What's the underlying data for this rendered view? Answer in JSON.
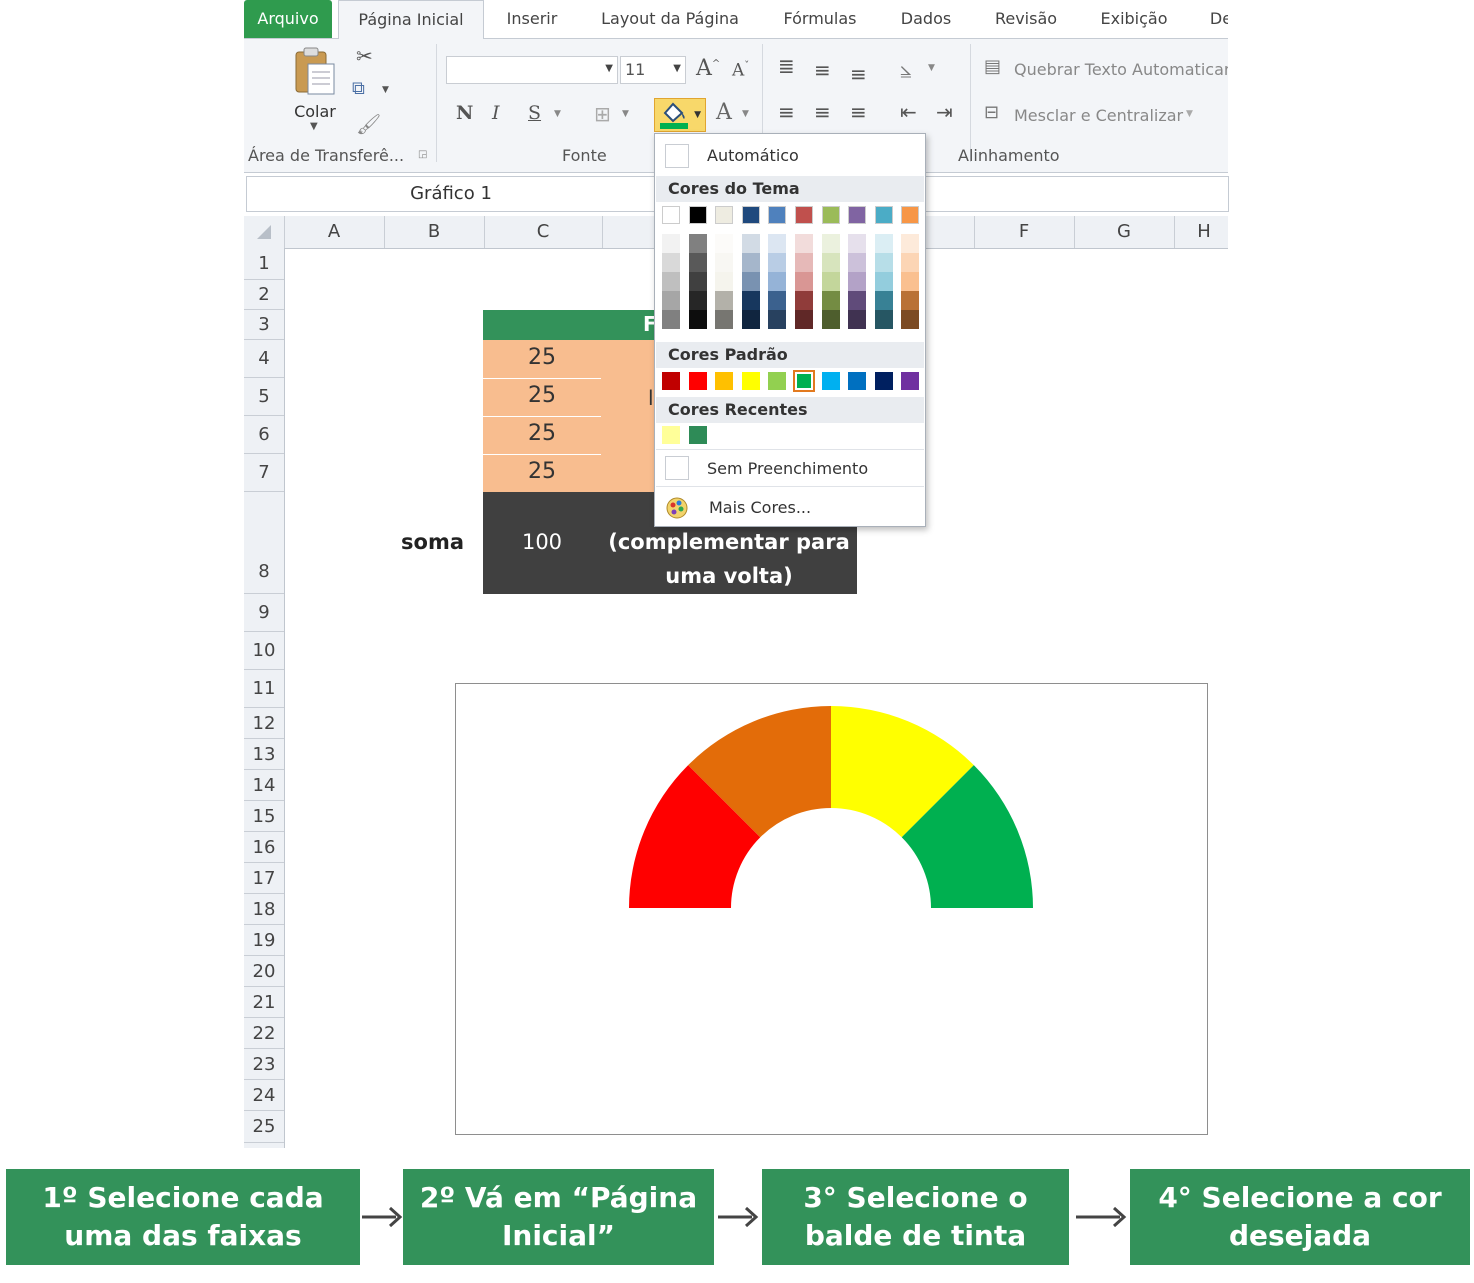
{
  "ribbon": {
    "tabs": [
      "Arquivo",
      "Página Inicial",
      "Inserir",
      "Layout da Página",
      "Fórmulas",
      "Dados",
      "Revisão",
      "Exibição",
      "De"
    ],
    "clipboard": {
      "paste_label": "Colar",
      "group_label": "Área de Transferê..."
    },
    "font": {
      "font_name": "",
      "font_size": "11",
      "bold": "N",
      "italic": "I",
      "underline": "S",
      "group_label": "Fonte"
    },
    "alignment": {
      "wrap_text": "Quebrar Texto Automaticar",
      "merge_center": "Mesclar e Centralizar",
      "group_label": "Alinhamento"
    }
  },
  "namebox": {
    "value": "Gráfico 1"
  },
  "columns": [
    "A",
    "B",
    "C",
    "F",
    "G",
    "H"
  ],
  "rows": [
    "1",
    "2",
    "3",
    "4",
    "5",
    "6",
    "7",
    "8",
    "9",
    "10",
    "11",
    "12",
    "13",
    "14",
    "15",
    "16",
    "17",
    "18",
    "19",
    "20",
    "21",
    "22",
    "23",
    "24",
    "25"
  ],
  "sheet": {
    "header_partial": "F",
    "values": [
      "25",
      "25",
      "25",
      "25"
    ],
    "hidden_partial": "l",
    "sum_label": "soma",
    "sum_value": "100",
    "note_line1": "(complementar para",
    "note_line2": "uma volta)"
  },
  "color_menu": {
    "automatic": "Automático",
    "theme_header": "Cores do Tema",
    "standard_header": "Cores Padrão",
    "recent_header": "Cores Recentes",
    "no_fill": "Sem Preenchimento",
    "more_colors": "Mais Cores...",
    "theme_base": [
      "#ffffff",
      "#000000",
      "#eeece1",
      "#1f497d",
      "#4f81bd",
      "#c0504d",
      "#9bbb59",
      "#8064a2",
      "#4bacc6",
      "#f79646"
    ],
    "standard": [
      "#c00000",
      "#ff0000",
      "#ffc000",
      "#ffff00",
      "#92d050",
      "#00b050",
      "#00b0f0",
      "#0070c0",
      "#002060",
      "#7030a0"
    ],
    "recent": [
      "#ffff99",
      "#2e8b57"
    ],
    "selected_standard": "#00b050"
  },
  "chart_data": {
    "type": "pie",
    "subtype": "half-donut gauge",
    "categories": [
      "",
      "",
      "",
      ""
    ],
    "values": [
      25,
      25,
      25,
      25,
      100
    ],
    "colors": [
      "#ff0000",
      "#e36c09",
      "#ffff00",
      "#00b050",
      "#ffffff"
    ],
    "title": ""
  },
  "steps": [
    "1º Selecione cada uma das faixas",
    "2º Vá em “Página Inicial”",
    "3° Selecione o balde de tinta",
    "4° Selecione a cor desejada"
  ]
}
